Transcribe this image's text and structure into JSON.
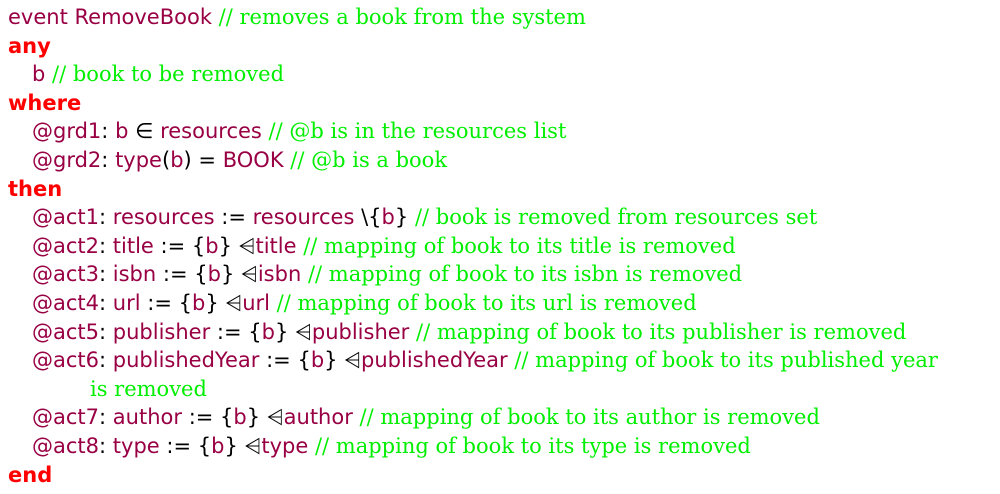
{
  "event_header": {
    "keyword": "event",
    "name": "RemoveBook",
    "comment": "// removes a book from the system"
  },
  "any": {
    "keyword": "any",
    "param": "b",
    "param_comment": "// book to be removed"
  },
  "where": {
    "keyword": "where",
    "guards": [
      {
        "label": "@grd1",
        "lhs": "b",
        "op": "∈",
        "rhs": "resources",
        "comment": "// @b is in the resources list"
      },
      {
        "label": "@grd2",
        "func": "type",
        "arg": "b",
        "op": "=",
        "rhs": "BOOK",
        "comment": "// @b is a book"
      }
    ]
  },
  "then": {
    "keyword": "then",
    "actions": [
      {
        "label": "@act1",
        "var": "resources",
        "assign": ":=",
        "expr_var": "resources",
        "expr_op": "\\",
        "set_elem": "b",
        "comment": "// book is removed from resources set"
      },
      {
        "label": "@act2",
        "var": "title",
        "assign": ":=",
        "set_elem": "b",
        "sym": "⩤",
        "rel": "title",
        "comment": "// mapping of book to its title is removed"
      },
      {
        "label": "@act3",
        "var": "isbn",
        "assign": ":=",
        "set_elem": "b",
        "sym": "⩤",
        "rel": "isbn",
        "comment": "// mapping of book to its isbn is removed"
      },
      {
        "label": "@act4",
        "var": "url",
        "assign": ":=",
        "set_elem": "b",
        "sym": "⩤",
        "rel": "url",
        "comment": "// mapping of book to its url is removed"
      },
      {
        "label": "@act5",
        "var": "publisher",
        "assign": ":=",
        "set_elem": "b",
        "sym": "⩤",
        "rel": "publisher",
        "comment": "// mapping of book to its publisher is removed"
      },
      {
        "label": "@act6",
        "var": "publishedYear",
        "assign": ":=",
        "set_elem": "b",
        "sym": "⩤",
        "rel": "publishedYear",
        "comment": "// mapping of book to its published year",
        "comment_cont": "is removed"
      },
      {
        "label": "@act7",
        "var": "author",
        "assign": ":=",
        "set_elem": "b",
        "sym": "⩤",
        "rel": "author",
        "comment": "// mapping of book to its author is removed"
      },
      {
        "label": "@act8",
        "var": "type",
        "assign": ":=",
        "set_elem": "b",
        "sym": "⩤",
        "rel": "type",
        "comment": "// mapping of book to its type is removed"
      }
    ]
  },
  "end": {
    "keyword": "end"
  }
}
